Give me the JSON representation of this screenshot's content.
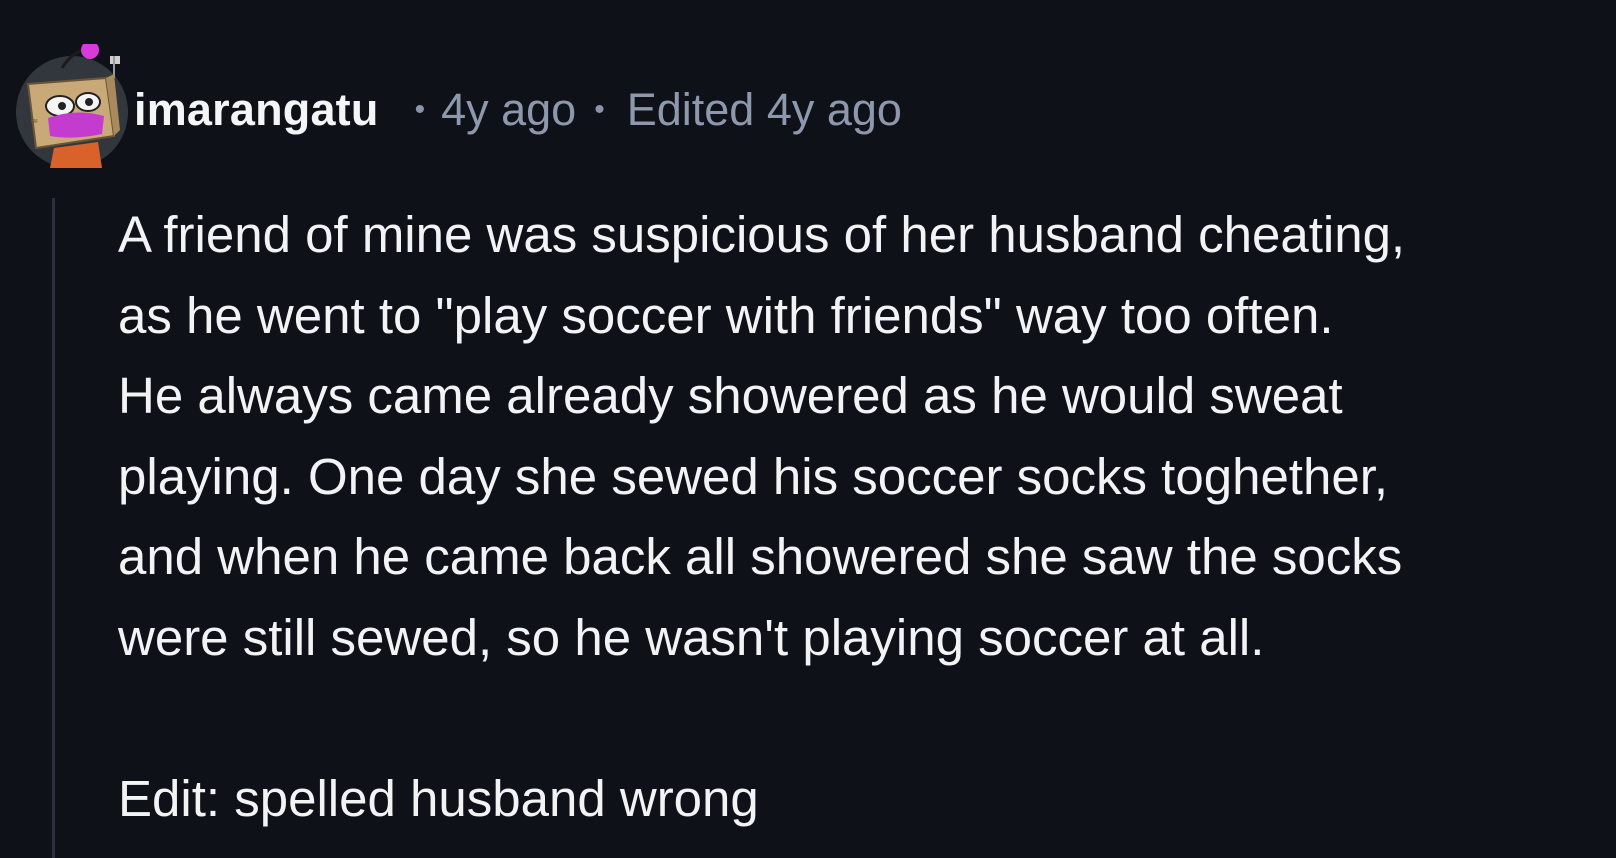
{
  "comment": {
    "author": "imarangatu",
    "age": "4y ago",
    "edited": "Edited 4y ago",
    "separator": "•",
    "body_lines": [
      "A friend of mine was suspicious of her husband cheating,",
      "as he went to \"play soccer with friends\" way too often.",
      "He always came already showered as he would sweat",
      "playing. One day she sewed his soccer socks toghether,",
      "and when he came back all showered she saw the socks",
      "were still sewed, so he wasn't playing soccer at all."
    ],
    "edit_note": "Edit: spelled husband wrong",
    "avatar_icon": "snoo-avatar-icon"
  },
  "colors": {
    "background": "#0e1117",
    "text": "#f2f3f5",
    "meta": "#8e98ad",
    "thread_line": "#2b313d",
    "accent": "#d93ad9"
  }
}
